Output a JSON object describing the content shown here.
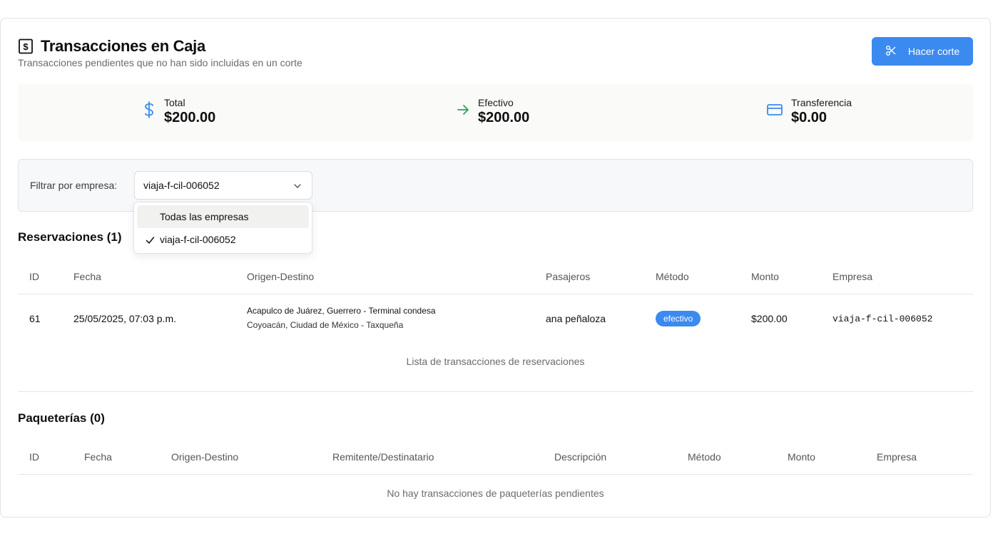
{
  "header": {
    "title": "Transacciones en Caja",
    "subtitle": "Transacciones pendientes que no han sido incluidas en un corte",
    "cut_button_label": "Hacer corte"
  },
  "summary": {
    "total": {
      "label": "Total",
      "value": "$200.00",
      "icon": "dollar-icon",
      "color": "#3b8af0"
    },
    "cash": {
      "label": "Efectivo",
      "value": "$200.00",
      "icon": "arrow-right-icon",
      "color": "#2fa05a"
    },
    "transfer": {
      "label": "Transferencia",
      "value": "$0.00",
      "icon": "credit-card-icon",
      "color": "#3b8af0"
    }
  },
  "filter": {
    "label": "Filtrar por empresa:",
    "selected": "viaja-f-cil-006052",
    "options": [
      {
        "label": "Todas las empresas",
        "checked": false
      },
      {
        "label": "viaja-f-cil-006052",
        "checked": true
      }
    ]
  },
  "reservations": {
    "title": "Reservaciones (1)",
    "columns": [
      "ID",
      "Fecha",
      "Origen-Destino",
      "Pasajeros",
      "Método",
      "Monto",
      "Empresa"
    ],
    "rows": [
      {
        "id": "61",
        "date": "25/05/2025, 07:03 p.m.",
        "origin": "Acapulco de Juárez, Guerrero - Terminal condesa",
        "destination": "Coyoacán, Ciudad de México - Taxqueña",
        "passengers": "ana peñaloza",
        "method": "efectivo",
        "amount": "$200.00",
        "company": "viaja-f-cil-006052"
      }
    ],
    "caption": "Lista de transacciones de reservaciones"
  },
  "parcels": {
    "title": "Paqueterías (0)",
    "columns": [
      "ID",
      "Fecha",
      "Origen-Destino",
      "Remitente/Destinatario",
      "Descripción",
      "Método",
      "Monto",
      "Empresa"
    ],
    "empty": "No hay transacciones de paqueterías pendientes"
  },
  "colors": {
    "accent": "#3b8af0",
    "success": "#2fa05a"
  }
}
